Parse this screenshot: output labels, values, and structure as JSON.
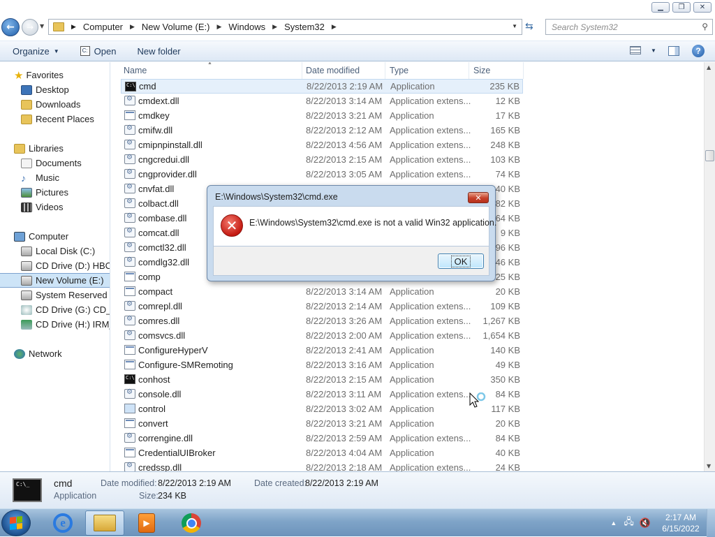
{
  "address": {
    "crumbs": [
      "Computer",
      "New Volume (E:)",
      "Windows",
      "System32"
    ],
    "search_placeholder": "Search System32"
  },
  "toolbar": {
    "organize": "Organize",
    "open": "Open",
    "new_folder": "New folder"
  },
  "nav": {
    "favorites": "Favorites",
    "desktop": "Desktop",
    "downloads": "Downloads",
    "recent": "Recent Places",
    "libraries": "Libraries",
    "documents": "Documents",
    "music": "Music",
    "pictures": "Pictures",
    "videos": "Videos",
    "computer": "Computer",
    "local_c": "Local Disk (C:)",
    "cd_d": "CD Drive (D:) HBCD_",
    "new_e": "New Volume (E:)",
    "reserved_f": "System Reserved (F:)",
    "cd_g": "CD Drive (G:) CD_RC",
    "cd_h": "CD Drive (H:) IRM_SI",
    "network": "Network"
  },
  "columns": {
    "name": "Name",
    "date": "Date modified",
    "type": "Type",
    "size": "Size"
  },
  "files": [
    {
      "name": "cmd",
      "date": "8/22/2013 2:19 AM",
      "type": "Application",
      "size": "235 KB"
    },
    {
      "name": "cmdext.dll",
      "date": "8/22/2013 3:14 AM",
      "type": "Application extens...",
      "size": "12 KB"
    },
    {
      "name": "cmdkey",
      "date": "8/22/2013 3:21 AM",
      "type": "Application",
      "size": "17 KB"
    },
    {
      "name": "cmifw.dll",
      "date": "8/22/2013 2:12 AM",
      "type": "Application extens...",
      "size": "165 KB"
    },
    {
      "name": "cmipnpinstall.dll",
      "date": "8/22/2013 4:56 AM",
      "type": "Application extens...",
      "size": "248 KB"
    },
    {
      "name": "cngcredui.dll",
      "date": "8/22/2013 2:15 AM",
      "type": "Application extens...",
      "size": "103 KB"
    },
    {
      "name": "cngprovider.dll",
      "date": "8/22/2013 3:05 AM",
      "type": "Application extens...",
      "size": "74 KB"
    },
    {
      "name": "cnvfat.dll",
      "date": "",
      "type": "",
      "size": "40 KB"
    },
    {
      "name": "colbact.dll",
      "date": "",
      "type": "",
      "size": "82 KB"
    },
    {
      "name": "combase.dll",
      "date": "",
      "type": "",
      "size": "964 KB"
    },
    {
      "name": "comcat.dll",
      "date": "",
      "type": "",
      "size": "9 KB"
    },
    {
      "name": "comctl32.dll",
      "date": "",
      "type": "",
      "size": "796 KB"
    },
    {
      "name": "comdlg32.dll",
      "date": "",
      "type": "",
      "size": "546 KB"
    },
    {
      "name": "comp",
      "date": "",
      "type": "",
      "size": "25 KB"
    },
    {
      "name": "compact",
      "date": "8/22/2013 3:14 AM",
      "type": "Application",
      "size": "20 KB"
    },
    {
      "name": "comrepl.dll",
      "date": "8/22/2013 2:14 AM",
      "type": "Application extens...",
      "size": "109 KB"
    },
    {
      "name": "comres.dll",
      "date": "8/22/2013 3:26 AM",
      "type": "Application extens...",
      "size": "1,267 KB"
    },
    {
      "name": "comsvcs.dll",
      "date": "8/22/2013 2:00 AM",
      "type": "Application extens...",
      "size": "1,654 KB"
    },
    {
      "name": "ConfigureHyperV",
      "date": "8/22/2013 2:41 AM",
      "type": "Application",
      "size": "140 KB"
    },
    {
      "name": "Configure-SMRemoting",
      "date": "8/22/2013 3:16 AM",
      "type": "Application",
      "size": "49 KB"
    },
    {
      "name": "conhost",
      "date": "8/22/2013 2:15 AM",
      "type": "Application",
      "size": "350 KB"
    },
    {
      "name": "console.dll",
      "date": "8/22/2013 3:11 AM",
      "type": "Application extens...",
      "size": "84 KB"
    },
    {
      "name": "control",
      "date": "8/22/2013 3:02 AM",
      "type": "Application",
      "size": "117 KB"
    },
    {
      "name": "convert",
      "date": "8/22/2013 3:21 AM",
      "type": "Application",
      "size": "20 KB"
    },
    {
      "name": "correngine.dll",
      "date": "8/22/2013 2:59 AM",
      "type": "Application extens...",
      "size": "84 KB"
    },
    {
      "name": "CredentialUIBroker",
      "date": "8/22/2013 4:04 AM",
      "type": "Application",
      "size": "40 KB"
    },
    {
      "name": "credssp.dll",
      "date": "8/22/2013 2:18 AM",
      "type": "Application extens...",
      "size": "24 KB"
    }
  ],
  "file_icons": [
    "console",
    "dll",
    "exe",
    "dll",
    "dll",
    "dll",
    "dll",
    "dll",
    "dll",
    "dll",
    "dll",
    "dll",
    "dll",
    "exe",
    "exe",
    "dll",
    "dll",
    "dll",
    "exe",
    "exe",
    "console",
    "dll",
    "cpl",
    "exe",
    "dll",
    "exe",
    "dll"
  ],
  "details": {
    "name": "cmd",
    "kind": "Application",
    "date_modified_label": "Date modified:",
    "date_modified": "8/22/2013 2:19 AM",
    "date_created_label": "Date created:",
    "date_created": "8/22/2013 2:19 AM",
    "size_label": "Size:",
    "size": "234 KB"
  },
  "dialog": {
    "title": "E:\\Windows\\System32\\cmd.exe",
    "message": "E:\\Windows\\System32\\cmd.exe is not a valid Win32 application.",
    "ok": "OK"
  },
  "clock": {
    "time": "2:17 AM",
    "date": "6/15/2022"
  }
}
